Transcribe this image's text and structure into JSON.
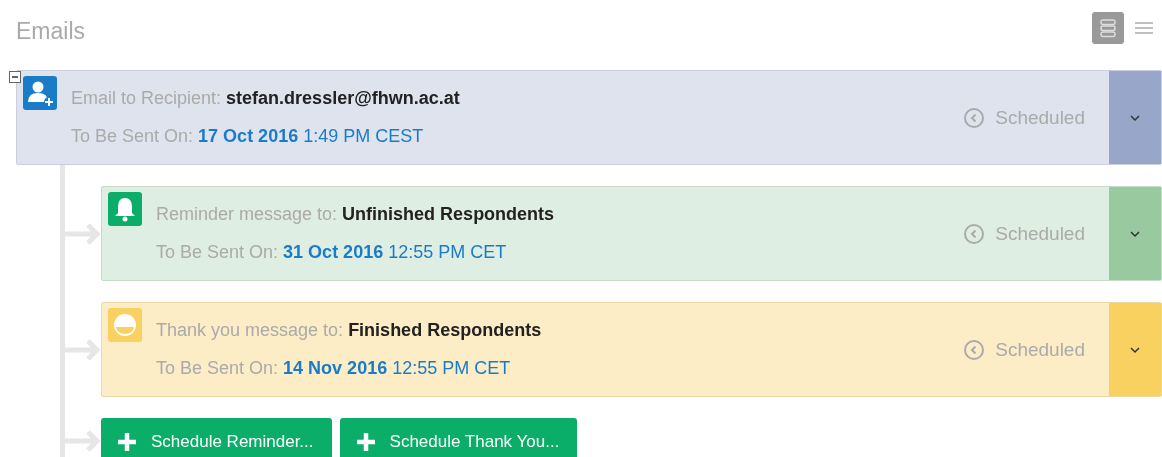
{
  "title": "Emails",
  "view_toggle": [
    {
      "kind": "cards",
      "selected": true
    },
    {
      "kind": "list",
      "selected": false
    }
  ],
  "tree": {
    "expanded": true
  },
  "emails": [
    {
      "kind": "recipient",
      "label": "Email to Recipient:",
      "target": "stefan.dressler@fhwn.ac.at",
      "sent_label": "To Be Sent On:",
      "date": "17 Oct 2016",
      "time": "1:49 PM CEST",
      "status": "Scheduled"
    },
    {
      "kind": "reminder",
      "label": "Reminder message to:",
      "target": "Unfinished Respondents",
      "sent_label": "To Be Sent On:",
      "date": "31 Oct 2016",
      "time": "12:55 PM CET",
      "status": "Scheduled"
    },
    {
      "kind": "thankyou",
      "label": "Thank you message to:",
      "target": "Finished Respondents",
      "sent_label": "To Be Sent On:",
      "date": "14 Nov 2016",
      "time": "12:55 PM CET",
      "status": "Scheduled"
    }
  ],
  "buttons": [
    "Schedule Reminder...",
    "Schedule Thank You..."
  ]
}
